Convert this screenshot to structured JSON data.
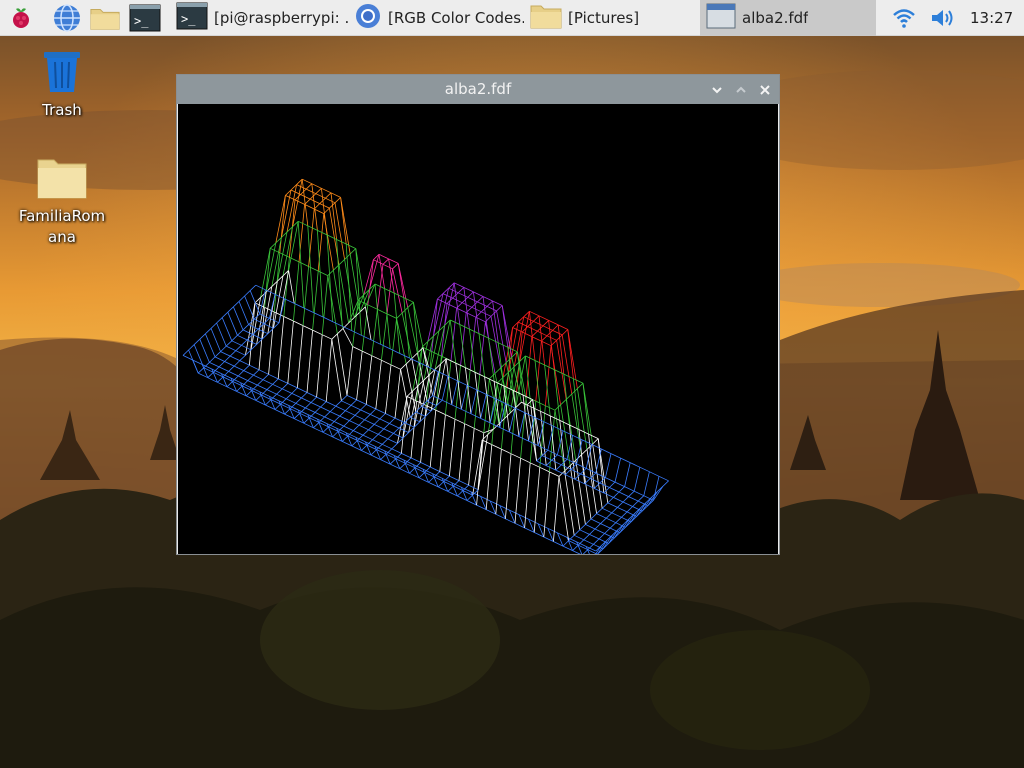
{
  "taskbar": {
    "launchers": [
      {
        "name": "raspberry-menu-icon"
      },
      {
        "name": "web-browser-icon"
      },
      {
        "name": "file-manager-icon"
      },
      {
        "name": "terminal-icon"
      }
    ],
    "tasks": [
      {
        "label": "[pi@raspberrypi: ...",
        "icon": "terminal-icon",
        "active": false
      },
      {
        "label": "[RGB Color Codes...",
        "icon": "chromium-icon",
        "active": false
      },
      {
        "label": "[Pictures]",
        "icon": "folder-icon",
        "active": false
      },
      {
        "label": "alba2.fdf",
        "icon": "window-icon",
        "active": true
      }
    ],
    "tray": {
      "wifi": "wifi-icon",
      "volume": "volume-icon",
      "clock": "13:27"
    }
  },
  "desktop": {
    "icons": [
      {
        "label": "Trash",
        "icon": "trash-icon"
      },
      {
        "label": "FamiliaRomana",
        "icon": "folder-icon"
      }
    ]
  },
  "window": {
    "title": "alba2.fdf",
    "controls": [
      "minimize-icon",
      "maximize-icon",
      "close-icon"
    ],
    "content": "3D wireframe height map render",
    "colors": {
      "base_grid": "#3a7dff",
      "walls": "#ffffff",
      "mid": "#39c43a",
      "peaks": [
        "#ff8c1a",
        "#ff2aa0",
        "#a030e0",
        "#ff2020"
      ]
    }
  },
  "colors": {
    "taskbar_bg": "#ededed",
    "titlebar_bg": "#8e979c",
    "canvas_bg": "#000000"
  }
}
